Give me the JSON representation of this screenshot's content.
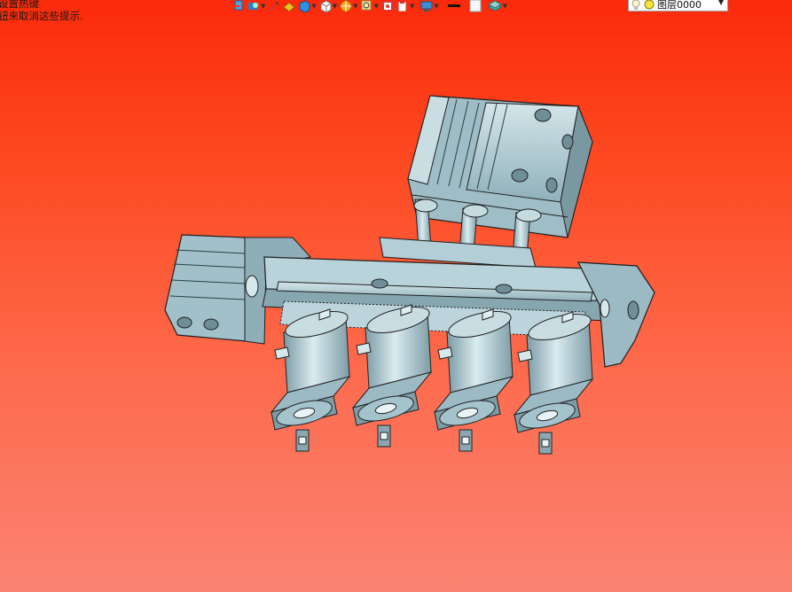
{
  "hint": {
    "line1": "设置热键",
    "line2": "钮来取消这些提示."
  },
  "toolbar": {
    "icons": [
      "select-icon",
      "view-icon",
      "sketch-icon",
      "feature-icon",
      "shape-icon",
      "cube-icon",
      "lighting-icon",
      "zoom-icon",
      "color-icon",
      "clipboard-icon",
      "monitor-icon",
      "line-style-icon",
      "color-box-icon",
      "layers-icon"
    ],
    "layer_selector": {
      "value": "图层0000"
    }
  },
  "colors": {
    "bg_top": "#fb2a0a",
    "bg_bottom": "#fb8373",
    "metal": "#a9c6cf",
    "metal_dark": "#6f8e98",
    "metal_light": "#d8eaee"
  }
}
